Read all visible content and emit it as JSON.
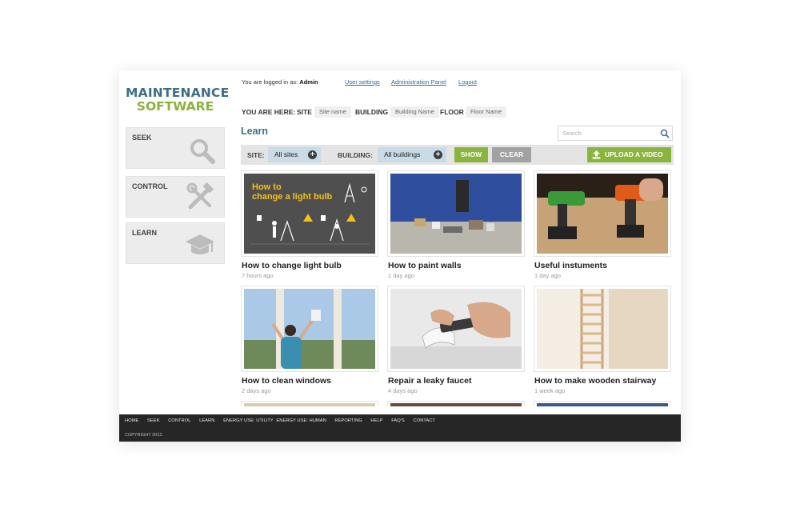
{
  "logo": {
    "line1": "MAINTENANCE",
    "line2": "SOFTWARE"
  },
  "nav": [
    {
      "label": "SEEK"
    },
    {
      "label": "CONTROL"
    },
    {
      "label": "LEARN"
    }
  ],
  "topbar": {
    "logged_in_prefix": "You are logged in as:",
    "user": "Admin",
    "links": [
      "User settings",
      "Administration Panel",
      "Logout"
    ]
  },
  "breadcrumb": {
    "label": "YOU ARE HERE:",
    "site_key": "SITE",
    "site_value": "Site name",
    "building_key": "BUILDING",
    "building_value": "Building Name",
    "floor_key": "FLOOR",
    "floor_value": "Floor Name"
  },
  "page_title": "Learn",
  "search": {
    "placeholder": "Search"
  },
  "filter": {
    "site_label": "SITE:",
    "site_value": "All sites",
    "building_label": "BUILDING:",
    "building_value": "All buildings",
    "show": "SHOW",
    "clear": "CLEAR",
    "upload": "UPLOAD A VIDEO"
  },
  "videos": [
    {
      "title": "How to change light bulb",
      "age": "7 hours ago",
      "thumb_text": [
        "How to",
        "change a light bulb"
      ]
    },
    {
      "title": "How to paint walls",
      "age": "1 day ago"
    },
    {
      "title": "Useful instuments",
      "age": "1 day ago"
    },
    {
      "title": "How to clean windows",
      "age": "2 days ago"
    },
    {
      "title": "Repair a leaky faucet",
      "age": "4 days ago"
    },
    {
      "title": "How to make wooden stairway",
      "age": "1 week ago"
    }
  ],
  "footer": {
    "links": [
      "HOME",
      "SEEK",
      "CONTROL",
      "LEARN",
      "ENERGY USE: UTILITY",
      "ENERGY USE: HUMAN",
      "REPORTING",
      "HELP",
      "FAQ'S",
      "CONTACT"
    ],
    "copyright": "COPYRIGHT 2013."
  },
  "colors": {
    "brand_blue": "#3c6f86",
    "brand_green": "#8bb23a",
    "select_bg": "#c8dbe6",
    "footer_bg": "#262626"
  }
}
